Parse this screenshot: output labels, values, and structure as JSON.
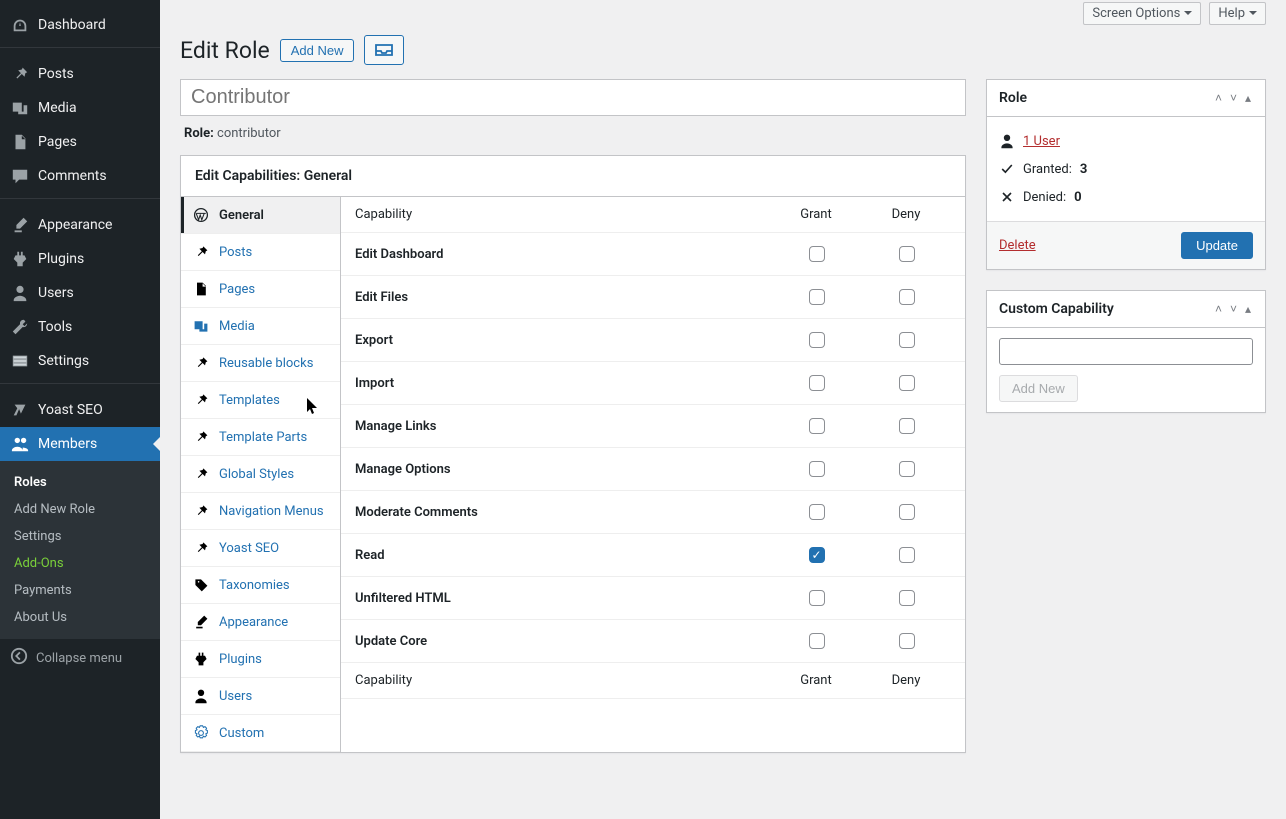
{
  "topbar": {
    "screen_options": "Screen Options",
    "help": "Help"
  },
  "header": {
    "title": "Edit Role",
    "add_new": "Add New"
  },
  "role": {
    "name_value": "Contributor",
    "slug_label": "Role:",
    "slug_value": "contributor"
  },
  "sidebar_menu": {
    "dashboard": "Dashboard",
    "posts": "Posts",
    "media": "Media",
    "pages": "Pages",
    "comments": "Comments",
    "appearance": "Appearance",
    "plugins": "Plugins",
    "users": "Users",
    "tools": "Tools",
    "settings": "Settings",
    "yoast": "Yoast SEO",
    "members": "Members",
    "collapse": "Collapse menu"
  },
  "submenu": {
    "roles": "Roles",
    "add_new_role": "Add New Role",
    "settings": "Settings",
    "addons": "Add-Ons",
    "payments": "Payments",
    "about": "About Us"
  },
  "caps_panel": {
    "title_prefix": "Edit Capabilities: ",
    "title_group": "General",
    "col_capability": "Capability",
    "col_grant": "Grant",
    "col_deny": "Deny",
    "footer_capability": "Capability",
    "footer_grant": "Grant",
    "footer_deny": "Deny"
  },
  "tabs": [
    {
      "label": "General",
      "icon": "wp"
    },
    {
      "label": "Posts",
      "icon": "pin"
    },
    {
      "label": "Pages",
      "icon": "page"
    },
    {
      "label": "Media",
      "icon": "media"
    },
    {
      "label": "Reusable blocks",
      "icon": "pin"
    },
    {
      "label": "Templates",
      "icon": "pin"
    },
    {
      "label": "Template Parts",
      "icon": "pin"
    },
    {
      "label": "Global Styles",
      "icon": "pin"
    },
    {
      "label": "Navigation Menus",
      "icon": "pin"
    },
    {
      "label": "Yoast SEO",
      "icon": "pin"
    },
    {
      "label": "Taxonomies",
      "icon": "tag"
    },
    {
      "label": "Appearance",
      "icon": "brush"
    },
    {
      "label": "Plugins",
      "icon": "plugin"
    },
    {
      "label": "Users",
      "icon": "user"
    },
    {
      "label": "Custom",
      "icon": "gear"
    }
  ],
  "capabilities": [
    {
      "name": "Edit Dashboard",
      "grant": false,
      "deny": false
    },
    {
      "name": "Edit Files",
      "grant": false,
      "deny": false
    },
    {
      "name": "Export",
      "grant": false,
      "deny": false
    },
    {
      "name": "Import",
      "grant": false,
      "deny": false
    },
    {
      "name": "Manage Links",
      "grant": false,
      "deny": false
    },
    {
      "name": "Manage Options",
      "grant": false,
      "deny": false
    },
    {
      "name": "Moderate Comments",
      "grant": false,
      "deny": false
    },
    {
      "name": "Read",
      "grant": true,
      "deny": false
    },
    {
      "name": "Unfiltered HTML",
      "grant": false,
      "deny": false
    },
    {
      "name": "Update Core",
      "grant": false,
      "deny": false
    }
  ],
  "rolebox": {
    "title": "Role",
    "users_link": "1 User",
    "granted_label": "Granted:",
    "granted_count": "3",
    "denied_label": "Denied:",
    "denied_count": "0",
    "delete": "Delete",
    "update": "Update"
  },
  "custombox": {
    "title": "Custom Capability",
    "addnew": "Add New"
  }
}
